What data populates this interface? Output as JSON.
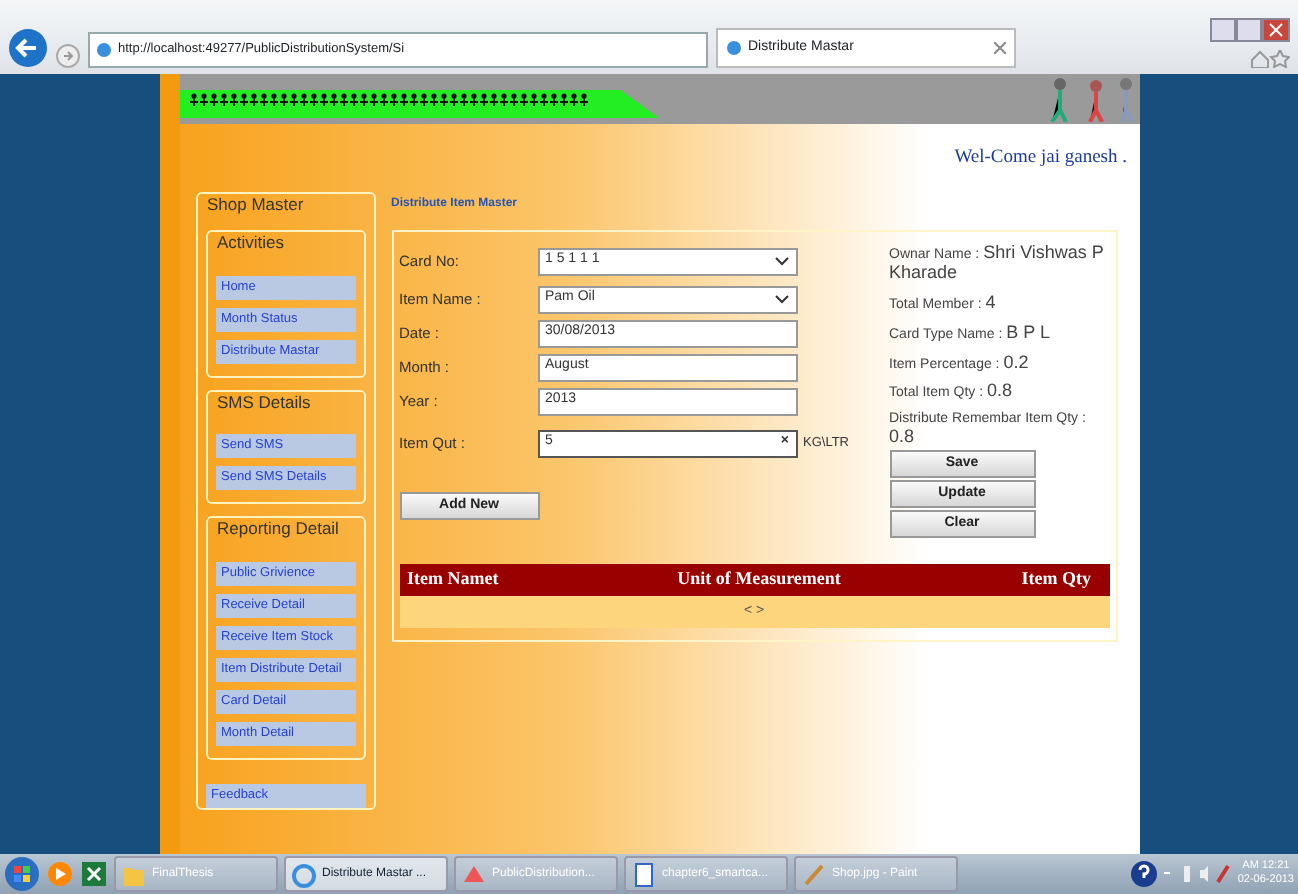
{
  "browser": {
    "address": "http://localhost:49277/PublicDistributionSystem/Si",
    "tab_title": "Distribute Mastar"
  },
  "header": {
    "welcome": "Wel-Come jai ganesh ."
  },
  "sidebar": {
    "title": "Shop Master",
    "groups": [
      {
        "title": "Activities",
        "items": [
          "Home",
          "Month Status",
          "Distribute Mastar"
        ]
      },
      {
        "title": "SMS Details",
        "items": [
          "Send SMS",
          "Send SMS Details"
        ]
      },
      {
        "title": "Reporting Detail",
        "items": [
          "Public Grivience",
          "Receive Detail",
          "Receive Item Stock",
          "Item Distribute Detail",
          "Card Detail",
          "Month Detail"
        ]
      }
    ],
    "footer_item": "Feedback"
  },
  "page_title": "Distribute Item Master",
  "form": {
    "fields": [
      {
        "label": "Card No:",
        "kind": "select",
        "value": "1 5 1 1 1"
      },
      {
        "label": "Item Name :",
        "kind": "select",
        "value": "Pam Oil"
      },
      {
        "label": "Date :",
        "kind": "text",
        "value": "30/08/2013"
      },
      {
        "label": "Month :",
        "kind": "text",
        "value": "August"
      },
      {
        "label": "Year :",
        "kind": "text",
        "value": "2013"
      },
      {
        "label": "Item Qut :",
        "kind": "clearable",
        "value": "5",
        "clear": "×",
        "unit": "KG\\LTR"
      }
    ],
    "add_button": "Add New"
  },
  "info": [
    {
      "label": "Ownar Name :",
      "value": "Shri Vishwas P Kharade"
    },
    {
      "label": "Total Member :",
      "value": "4"
    },
    {
      "label": "Card Type Name :",
      "value": "B P L"
    },
    {
      "label": "Item Percentage :",
      "value": "0.2"
    },
    {
      "label": "Total Item Qty :",
      "value": "0.8"
    },
    {
      "label": "Distribute Remembar Item Qty :",
      "value": "0.8"
    }
  ],
  "action_buttons": [
    "Save",
    "Update",
    "Clear"
  ],
  "table": {
    "columns": [
      "Item Namet",
      "Unit of Measurement",
      "Item Qty"
    ],
    "pager": "< >"
  },
  "taskbar": {
    "items": [
      {
        "label": "FinalThesis",
        "selected": false
      },
      {
        "label": "Distribute Mastar ...",
        "selected": true
      },
      {
        "label": "PublicDistribution...",
        "selected": false
      },
      {
        "label": "chapter6_smartca...",
        "selected": false
      },
      {
        "label": "Shop.jpg - Paint",
        "selected": false
      }
    ],
    "time": "AM 12:21",
    "date": "02-06-2013"
  }
}
